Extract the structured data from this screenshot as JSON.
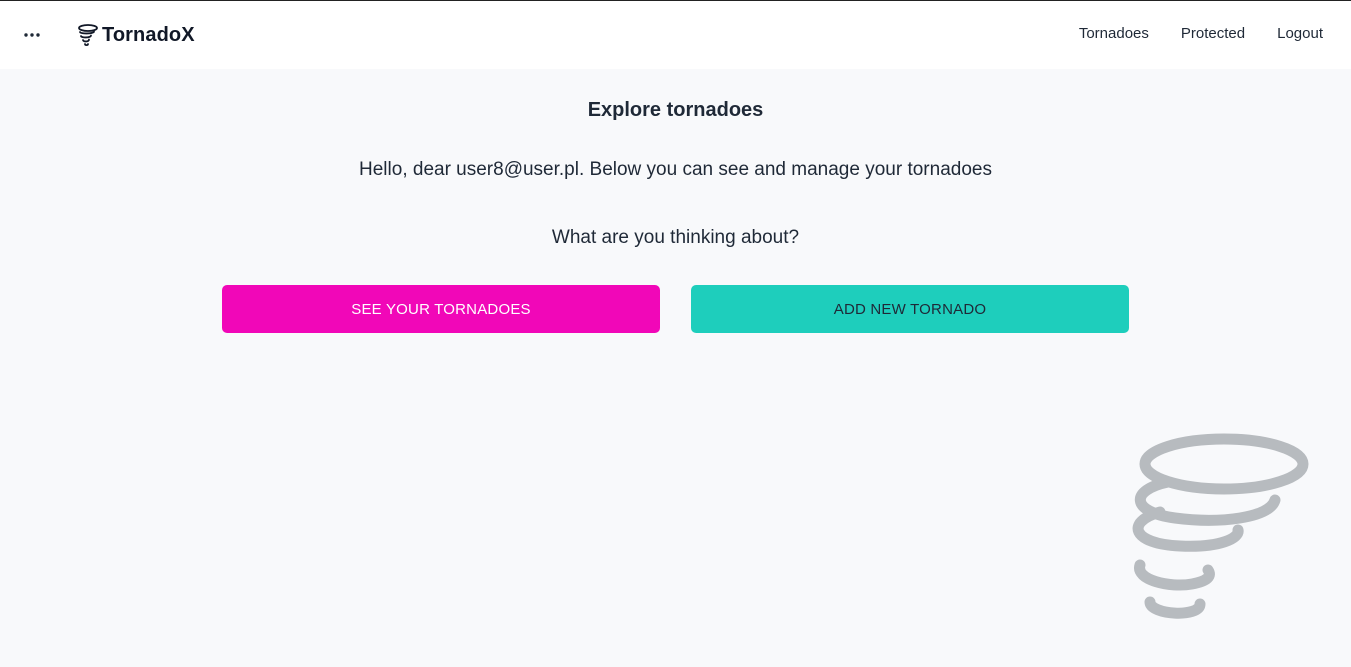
{
  "brand": {
    "name": "TornadoX",
    "logo_icon": "tornado-icon"
  },
  "header": {
    "menu_icon": "more-horizontal-icon",
    "nav": [
      {
        "label": "Tornadoes"
      },
      {
        "label": "Protected"
      },
      {
        "label": "Logout"
      }
    ]
  },
  "main": {
    "title": "Explore tornadoes",
    "greeting": "Hello, dear user8@user.pl. Below you can see and manage your tornadoes",
    "question": "What are you thinking about?",
    "primary_button": "SEE YOUR TORNADOES",
    "secondary_button": "ADD NEW TORNADO",
    "illustration_icon": "tornado-icon"
  },
  "colors": {
    "background": "#f8f9fb",
    "header": "#ffffff",
    "primary_button": "#f107b8",
    "secondary_button": "#1ecebc",
    "illustration": "#b7bbbf"
  }
}
